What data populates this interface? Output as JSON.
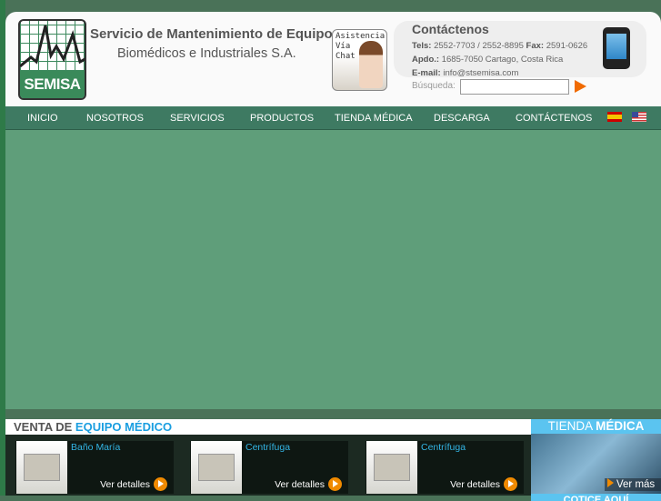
{
  "header": {
    "logo_text": "SEMISA",
    "title": "Servicio de Mantenimiento de Equipo",
    "subtitle": "Biomédicos e Industriales S.A.",
    "chat": [
      "Asistencia",
      "Vía",
      "Chat"
    ]
  },
  "contact": {
    "title": "Contáctenos",
    "tels_label": "Tels:",
    "tels": "2552-7703 / 2552-8895",
    "fax_label": "Fax:",
    "fax": "2591-0626",
    "apdo_label": "Apdo.:",
    "apdo": "1685-7050 Cartago, Costa Rica",
    "email_label": "E-mail:",
    "email": "info@stsemisa.com"
  },
  "search": {
    "label": "Búsqueda:",
    "value": ""
  },
  "nav": [
    "INICIO",
    "NOSOTROS",
    "SERVICIOS",
    "PRODUCTOS",
    "TIENDA MÉDICA",
    "DESCARGA",
    "CONTÁCTENOS"
  ],
  "venta": {
    "title_a": "VENTA DE",
    "title_b": "EQUIPO MÉDICO",
    "products": [
      {
        "name": "Baño María",
        "link": "Ver detalles"
      },
      {
        "name": "Centrífuga",
        "link": "Ver detalles"
      },
      {
        "name": "Centrífuga",
        "link": "Ver detalles"
      }
    ]
  },
  "tienda": {
    "title_a": "TIENDA",
    "title_b": "MÉDICA",
    "more": "Ver más",
    "cta": "COTICE AQUÍ"
  }
}
